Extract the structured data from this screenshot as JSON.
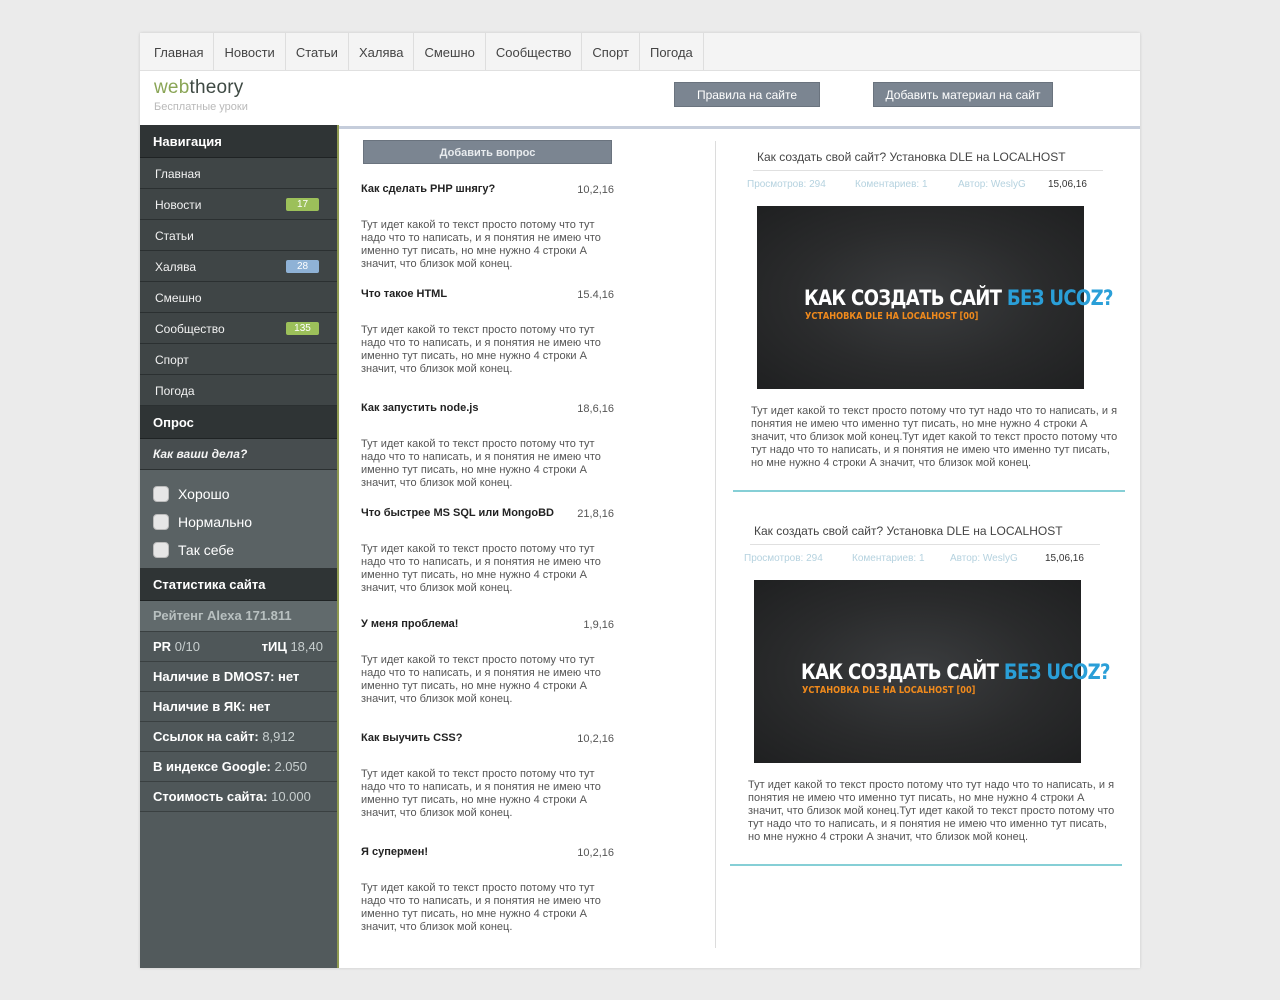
{
  "topnav": [
    "Главная",
    "Новости",
    "Статьи",
    "Халява",
    "Смешно",
    "Сообщество",
    "Спорт",
    "Погода"
  ],
  "header": {
    "logo_web": "web",
    "logo_theory": "theory",
    "tagline": "Бесплатные уроки",
    "rules_button": "Правила на сайте",
    "add_material_button": "Добавить материал на сайт"
  },
  "sidebar": {
    "nav_title": "Навигация",
    "items": [
      {
        "label": "Главная",
        "badge": ""
      },
      {
        "label": "Новости",
        "badge": "17"
      },
      {
        "label": "Статьи",
        "badge": ""
      },
      {
        "label": "Халява",
        "badge": "28"
      },
      {
        "label": "Смешно",
        "badge": ""
      },
      {
        "label": "Сообщество",
        "badge": "135"
      },
      {
        "label": "Спорт",
        "badge": ""
      },
      {
        "label": "Погода",
        "badge": ""
      }
    ],
    "poll_title": "Опрос",
    "poll_question": "Как ваши дела?",
    "poll_options": [
      "Хорошо",
      "Нормально",
      "Так себе"
    ],
    "stats_title": "Статистика сайта",
    "stats": {
      "alexa_label": "Рейтенг Alexa",
      "alexa_value": "171.811",
      "pr_label": "PR",
      "pr_value": "0/10",
      "tic_label": "тИЦ",
      "tic_value": "18,40",
      "dmoz": "Наличие в DMOS7: нет",
      "yak": "Наличие в ЯК: нет",
      "links_label": "Ссылок на сайт:",
      "links_value": "8,912",
      "google_label": "В индексе Google:",
      "google_value": "2.050",
      "cost_label": "Стоимость сайта:",
      "cost_value": "10.000"
    }
  },
  "questions": {
    "add_button": "Добавить вопрос",
    "items": [
      {
        "title": "Как сделать PHP шнягу?",
        "date": "10,2,16",
        "text": "Тут идет какой то текст просто потому что тут надо что то написать, и я понятия не имею что именно тут писать, но мне нужно 4 строки А значит, что близок мой конец."
      },
      {
        "title": "Что такое HTML",
        "date": "15.4,16",
        "text": "Тут идет какой то текст просто потому что тут надо что то написать, и я понятия не имею что именно тут писать, но мне нужно 4 строки А значит, что близок мой конец."
      },
      {
        "title": "Как запустить node.js",
        "date": "18,6,16",
        "text": "Тут идет какой то текст просто потому что тут надо что то написать, и я понятия не имею что именно тут писать, но мне нужно 4 строки А значит, что близок мой конец."
      },
      {
        "title": "Что быстрее MS SQL или MongoBD",
        "date": "21,8,16",
        "text": "Тут идет какой то текст просто потому что тут надо что то написать, и я понятия не имею что именно тут писать, но мне нужно 4 строки А значит, что близок мой конец."
      },
      {
        "title": "У меня проблема!",
        "date": "1,9,16",
        "text": "Тут идет какой то текст просто потому что тут надо что то написать, и я понятия не имею что именно тут писать, но мне нужно 4 строки А значит, что близок мой конец."
      },
      {
        "title": "Как выучить CSS?",
        "date": "10,2,16",
        "text": "Тут идет какой то текст просто потому что тут надо что то написать, и я понятия не имею что именно тут писать, но мне нужно 4 строки А значит, что близок мой конец."
      },
      {
        "title": "Я супермен!",
        "date": "10,2,16",
        "text": "Тут идет какой то текст просто потому что тут надо что то написать, и я понятия не имею что именно тут писать, но мне нужно 4 строки А значит, что близок мой конец."
      }
    ]
  },
  "articles": [
    {
      "title": "Как создать свой сайт? Установка DLE на LOCALHOST",
      "views": "Просмотров: 294",
      "comments": "Коментариев: 1",
      "author": "Автор: WeslyG",
      "date": "15,06,16",
      "image_main_white": "КАК СОЗДАТЬ САЙТ ",
      "image_main_blue": "БЕЗ UCOZ?",
      "image_sub": "УСТАНОВКА DLE НА LOCALHOST  [00]",
      "text": "Тут идет какой то текст просто потому что тут надо что то написать, и я понятия не имею что именно тут писать, но мне нужно 4 строки А значит, что близок мой конец.Тут идет какой то текст просто потому  что тут надо что то написать, и я понятия не имею что именно тут писать, но мне нужно 4 строки А значит, что близок мой конец."
    },
    {
      "title": "Как создать свой сайт? Установка DLE на LOCALHOST",
      "views": "Просмотров: 294",
      "comments": "Коментариев: 1",
      "author": "Автор: WeslyG",
      "date": "15,06,16",
      "image_main_white": "КАК СОЗДАТЬ САЙТ ",
      "image_main_blue": "БЕЗ UCOZ?",
      "image_sub": "УСТАНОВКА DLE НА LOCALHOST  [00]",
      "text": "Тут идет какой то текст просто потому что тут надо что то написать, и я понятия не имею что именно тут писать, но мне нужно 4 строки А значит, что близок мой конец.Тут идет какой то текст просто потому  что тут надо что то написать, и я понятия не имею что именно тут писать, но мне нужно 4 строки А значит, что близок мой конец."
    }
  ],
  "colors": {
    "sidebar_bg": "#525a5c",
    "button_bg": "#7b8591",
    "logo_green": "#8aa556",
    "badge_green": "#9cc05a",
    "badge_blue": "#8fb2d6",
    "article_rule": "#86cfd6"
  }
}
